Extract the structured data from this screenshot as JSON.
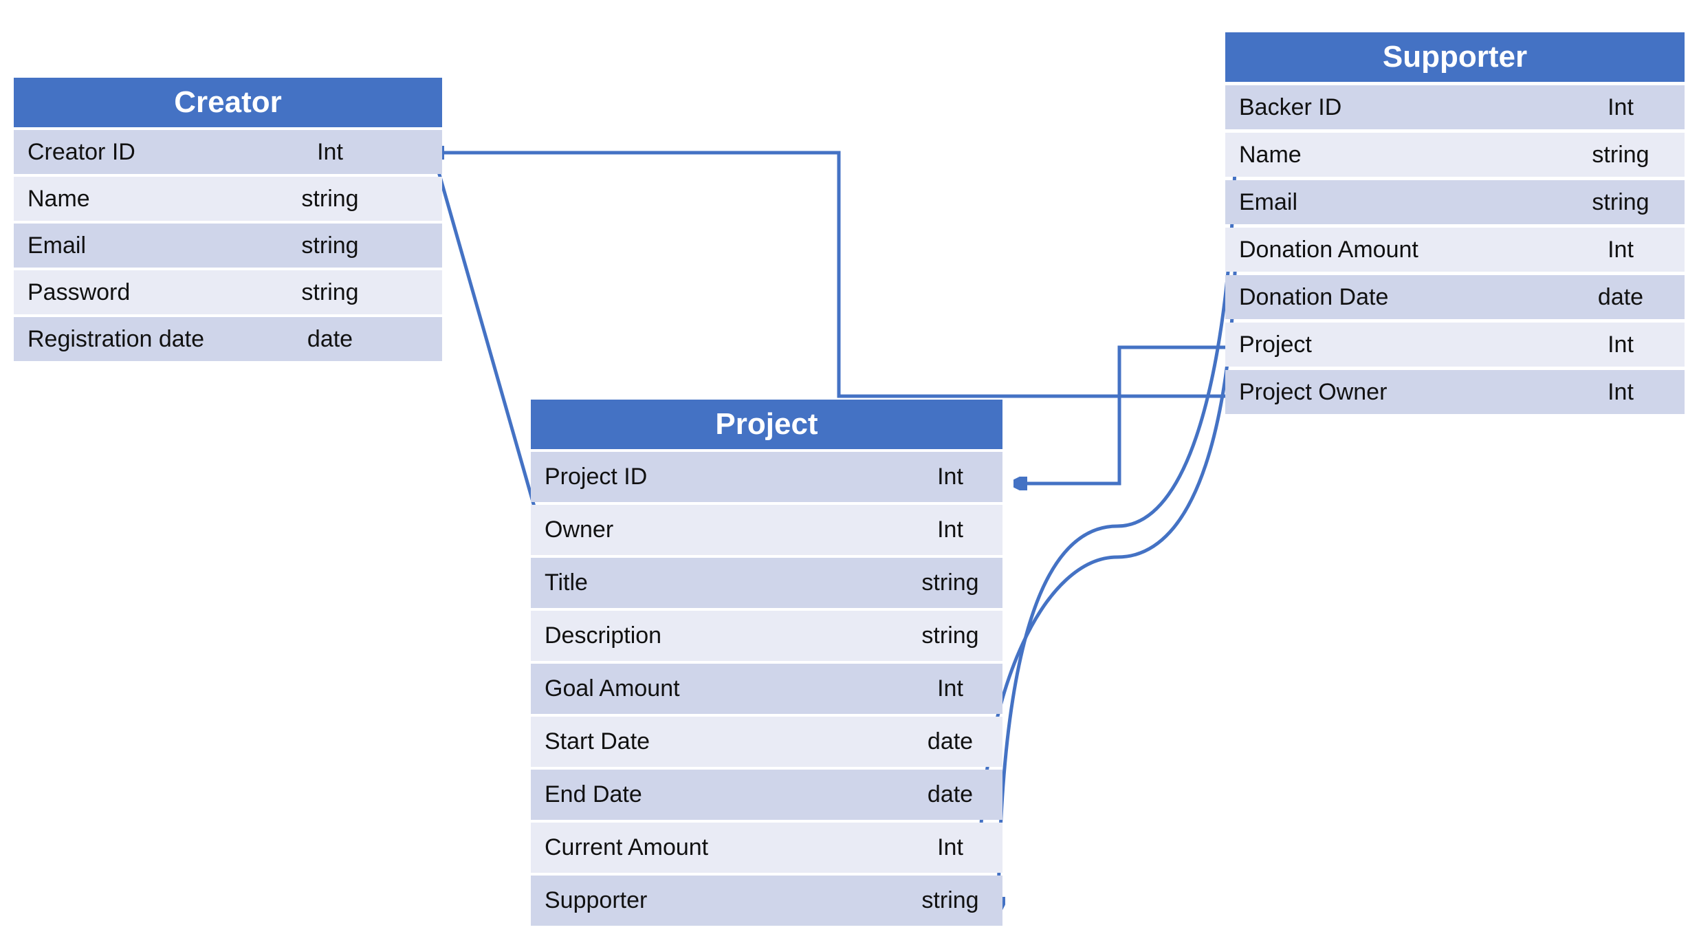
{
  "colors": {
    "header": "#4472C4",
    "row_dark": "#CFD5EA",
    "row_light": "#E9EBF5",
    "connector": "#4472C4"
  },
  "creator": {
    "title": "Creator",
    "fields": [
      {
        "name": "Creator ID",
        "type": "Int"
      },
      {
        "name": "Name",
        "type": "string"
      },
      {
        "name": "Email",
        "type": "string"
      },
      {
        "name": "Password",
        "type": "string"
      },
      {
        "name": "Registration date",
        "type": "date"
      }
    ]
  },
  "project": {
    "title": "Project",
    "fields": [
      {
        "name": "Project ID",
        "type": "Int"
      },
      {
        "name": "Owner",
        "type": "Int"
      },
      {
        "name": "Title",
        "type": "string"
      },
      {
        "name": "Description",
        "type": "string"
      },
      {
        "name": "Goal Amount",
        "type": "Int"
      },
      {
        "name": "Start Date",
        "type": "date"
      },
      {
        "name": "End Date",
        "type": "date"
      },
      {
        "name": "Current Amount",
        "type": "Int"
      },
      {
        "name": "Supporter",
        "type": "string"
      }
    ]
  },
  "supporter": {
    "title": "Supporter",
    "fields": [
      {
        "name": "Backer ID",
        "type": "Int"
      },
      {
        "name": "Name",
        "type": "string"
      },
      {
        "name": "Email",
        "type": "string"
      },
      {
        "name": "Donation Amount",
        "type": "Int"
      },
      {
        "name": "Donation Date",
        "type": "date"
      },
      {
        "name": "Project",
        "type": "Int"
      },
      {
        "name": "Project Owner",
        "type": "Int"
      }
    ]
  }
}
